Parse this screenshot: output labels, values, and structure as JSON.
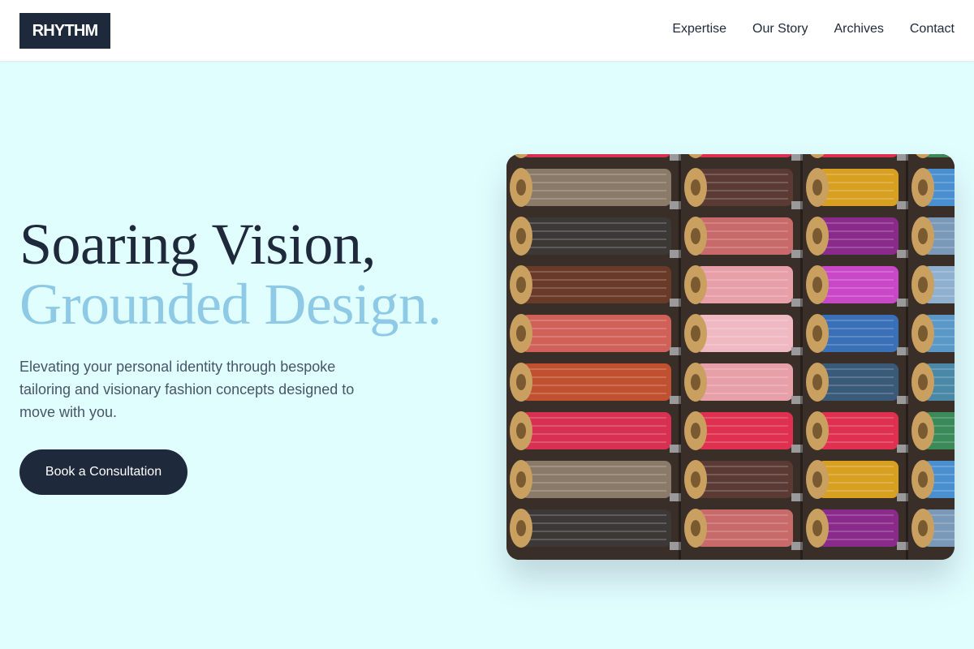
{
  "header": {
    "logo": "RHYTHM",
    "nav": [
      "Expertise",
      "Our Story",
      "Archives",
      "Contact"
    ]
  },
  "hero": {
    "title_line1": "Soaring Vision,",
    "title_line2": "Grounded Design.",
    "subtitle": "Elevating your personal identity through bespoke tailoring and visionary fashion concepts designed to move with you.",
    "cta_label": "Book a Consultation",
    "image": {
      "subject": "thread-spools-photo",
      "columns": [
        [
          "#8a7a68",
          "#3c3836",
          "#6a3a28",
          "#d06058",
          "#c05030",
          "#d83050"
        ],
        [
          "#5a3a32",
          "#c86a6a",
          "#e8a0a8",
          "#f0b8c0",
          "#e8a0a8",
          "#e03050"
        ],
        [
          "#d8a020",
          "#8a2a8a",
          "#c848c8",
          "#3a70b8",
          "#3a5a7a",
          "#e03050"
        ],
        [
          "#4a90d0",
          "#7a98b8",
          "#90b0d0",
          "#5a98c8",
          "#4a88a8",
          "#3a8a5a"
        ]
      ]
    }
  },
  "colors": {
    "background": "#e1feff",
    "dark": "#1e293b",
    "accent": "#8ecae6",
    "body_text": "#475569"
  }
}
